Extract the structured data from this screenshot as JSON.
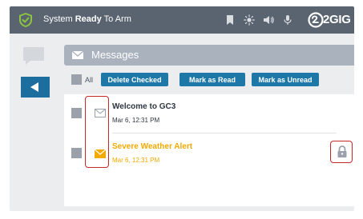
{
  "status_bar": {
    "status_prefix": "System ",
    "status_bold": "Ready",
    "status_suffix": " To Arm",
    "logo_text": "2GIG",
    "icons": [
      "shield-check-icon",
      "bookmark-icon",
      "brightness-icon",
      "volume-icon",
      "microphone-icon",
      "2gig-logo-icon"
    ]
  },
  "left_rail": {
    "icons": [
      "chat-bubble-icon",
      "back-arrow-icon"
    ]
  },
  "messages": {
    "title": "Messages",
    "toolbar": {
      "all_label": "All",
      "delete_checked": "Delete Checked",
      "mark_read": "Mark as Read",
      "mark_unread": "Mark as Unread"
    },
    "items": [
      {
        "title": "Welcome to GC3",
        "time": "Mar 6, 12:31 PM",
        "state": "read",
        "icon": "envelope-open-icon",
        "locked": false
      },
      {
        "title": "Severe Weather Alert",
        "time": "Mar 6, 12:31 PM",
        "state": "unread",
        "icon": "envelope-icon",
        "locked": true
      }
    ]
  },
  "colors": {
    "topbar": "#5a6470",
    "accent_blue": "#1d78a8",
    "unread_orange": "#f2a900",
    "highlight_red": "#c62828",
    "header_gray": "#a9b2bd"
  }
}
